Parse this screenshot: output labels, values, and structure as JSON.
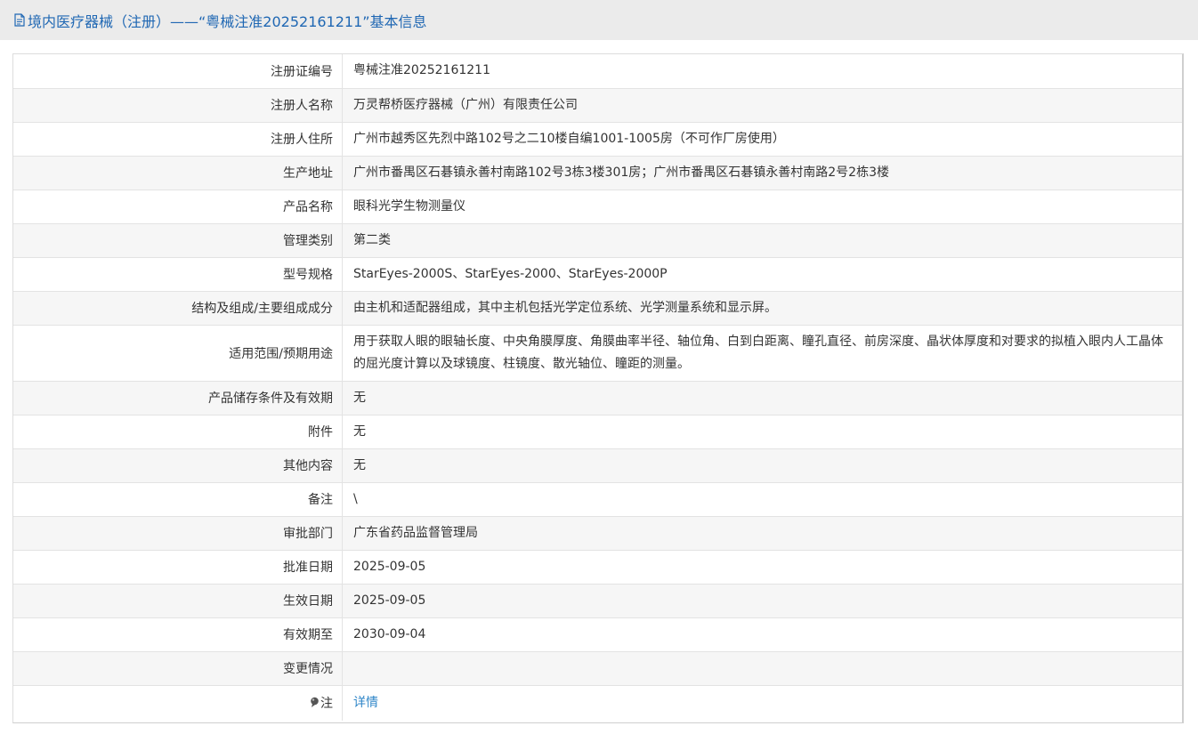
{
  "header": {
    "icon": "document-icon",
    "title": "境内医疗器械（注册）——“粤械注准20252161211”基本信息"
  },
  "rows": [
    {
      "label": "注册证编号",
      "value": "粤械注准20252161211"
    },
    {
      "label": "注册人名称",
      "value": "万灵帮桥医疗器械（广州）有限责任公司"
    },
    {
      "label": "注册人住所",
      "value": "广州市越秀区先烈中路102号之二10楼自编1001-1005房（不可作厂房使用）"
    },
    {
      "label": "生产地址",
      "value": "广州市番禺区石碁镇永善村南路102号3栋3楼301房；广州市番禺区石碁镇永善村南路2号2栋3楼"
    },
    {
      "label": "产品名称",
      "value": "眼科光学生物测量仪"
    },
    {
      "label": "管理类别",
      "value": "第二类"
    },
    {
      "label": "型号规格",
      "value": "StarEyes-2000S、StarEyes-2000、StarEyes-2000P"
    },
    {
      "label": "结构及组成/主要组成成分",
      "value": "由主机和适配器组成，其中主机包括光学定位系统、光学测量系统和显示屏。"
    },
    {
      "label": "适用范围/预期用途",
      "value": "用于获取人眼的眼轴长度、中央角膜厚度、角膜曲率半径、轴位角、白到白距离、瞳孔直径、前房深度、晶状体厚度和对要求的拟植入眼内人工晶体的屈光度计算以及球镜度、柱镜度、散光轴位、瞳距的测量。"
    },
    {
      "label": "产品储存条件及有效期",
      "value": "无"
    },
    {
      "label": "附件",
      "value": "无"
    },
    {
      "label": "其他内容",
      "value": "无"
    },
    {
      "label": "备注",
      "value": "\\"
    },
    {
      "label": "审批部门",
      "value": "广东省药品监督管理局"
    },
    {
      "label": "批准日期",
      "value": "2025-09-05"
    },
    {
      "label": "生效日期",
      "value": "2025-09-05"
    },
    {
      "label": "有效期至",
      "value": "2030-09-04"
    },
    {
      "label": "变更情况",
      "value": ""
    }
  ],
  "note_row": {
    "icon": "pin-icon",
    "label": "注",
    "link_text": "详情"
  },
  "colors": {
    "title_text": "#1f67b3",
    "title_bar_bg": "#ebebeb",
    "row_shade": "#f6f6f6",
    "link": "#2f86c8"
  }
}
